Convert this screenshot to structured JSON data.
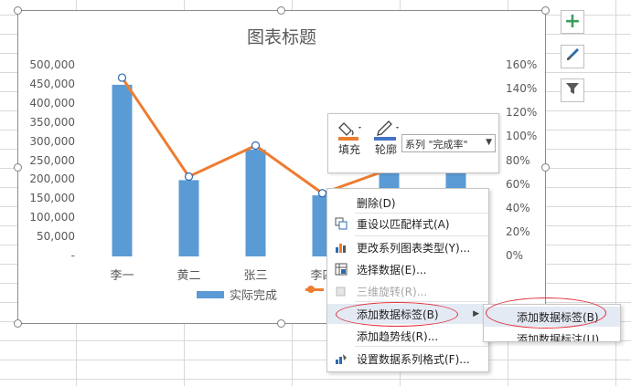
{
  "chart_data": {
    "type": "bar",
    "title": "图表标题",
    "categories": [
      "李一",
      "黄二",
      "张三",
      "李四",
      "",
      ""
    ],
    "series": [
      {
        "name": "实际完成",
        "type": "bar",
        "values": [
          450000,
          200000,
          280000,
          160000,
          220000,
          230000
        ]
      },
      {
        "name": "完成率",
        "type": "line",
        "axis": "right",
        "values": [
          1.5,
          0.67,
          0.93,
          0.53,
          0.73,
          0.77
        ]
      }
    ],
    "ylim": [
      0,
      500000
    ],
    "y_ticks": [
      "500,000",
      "450,000",
      "400,000",
      "350,000",
      "300,000",
      "250,000",
      "200,000",
      "150,000",
      "100,000",
      "50,000",
      "-"
    ],
    "y2lim": [
      0,
      1.6
    ],
    "y2_ticks": [
      "160%",
      "140%",
      "120%",
      "100%",
      "80%",
      "60%",
      "40%",
      "20%",
      "0%"
    ],
    "legend_position": "bottom",
    "colors": {
      "bar": "#5b9bd5",
      "line": "#ed7d31"
    }
  },
  "legend": {
    "bar_label": "实际完成"
  },
  "side_buttons": [
    {
      "icon": "plus-icon"
    },
    {
      "icon": "brush-icon"
    },
    {
      "icon": "funnel-icon"
    }
  ],
  "mini_toolbar": {
    "fill_label": "填充",
    "outline_label": "轮廓",
    "series_select": "系列 \"完成率\""
  },
  "context_menu": {
    "items": [
      {
        "label": "删除(D)",
        "icon": "delete-icon"
      },
      {
        "label": "重设以匹配样式(A)",
        "icon": "reset-style-icon"
      },
      {
        "label": "更改系列图表类型(Y)...",
        "icon": "chart-type-icon"
      },
      {
        "label": "选择数据(E)...",
        "icon": "select-data-icon"
      },
      {
        "label": "三维旋转(R)...",
        "icon": "rotate-3d-icon",
        "disabled": true
      },
      {
        "label": "添加数据标签(B)",
        "icon": "",
        "submenu": true
      },
      {
        "label": "添加趋势线(R)...",
        "icon": ""
      },
      {
        "label": "设置数据系列格式(F)...",
        "icon": "format-series-icon"
      }
    ]
  },
  "submenu": {
    "items": [
      {
        "label": "添加数据标签(B)"
      },
      {
        "label": "添加数据标注(U)"
      }
    ]
  }
}
